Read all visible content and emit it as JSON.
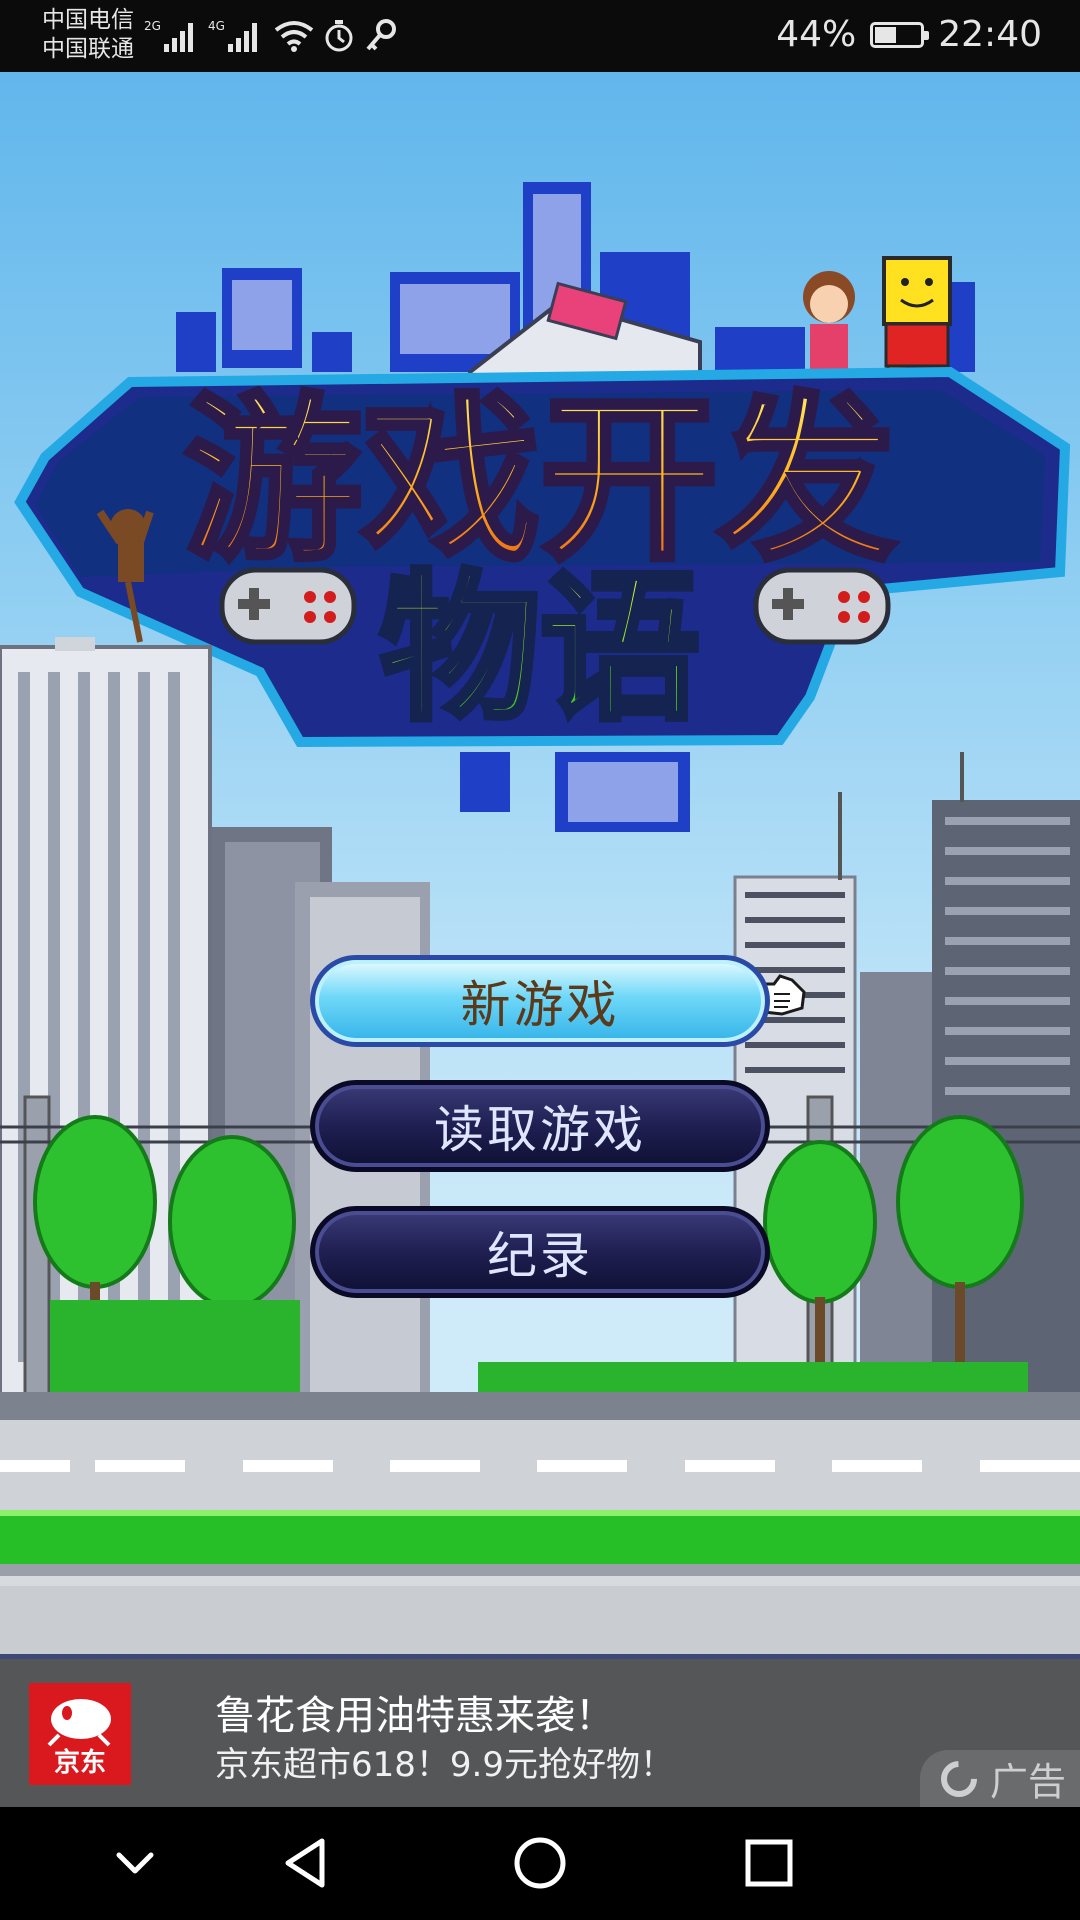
{
  "status": {
    "carrier1": "中国电信",
    "carrier2": "中国联通",
    "net1": "2G",
    "net2": "4G",
    "battery_percent": "44%",
    "battery_level": 0.44,
    "time": "22:40"
  },
  "game": {
    "title_line1": "游戏开发",
    "title_line2": "物语"
  },
  "menu": {
    "new_game": "新游戏",
    "load_game": "读取游戏",
    "records": "纪录"
  },
  "ad": {
    "brand": "京东",
    "title": "鲁花食用油特惠来袭！",
    "subtitle": "京东超市618！9.9元抢好物！",
    "tag": "广告"
  },
  "icons": {
    "statusbar": [
      "signal-icon",
      "wifi-icon",
      "alarm-icon",
      "key-icon",
      "battery-icon"
    ],
    "navbar": [
      "hide-keyboard-icon",
      "back-icon",
      "home-icon",
      "recents-icon"
    ]
  }
}
